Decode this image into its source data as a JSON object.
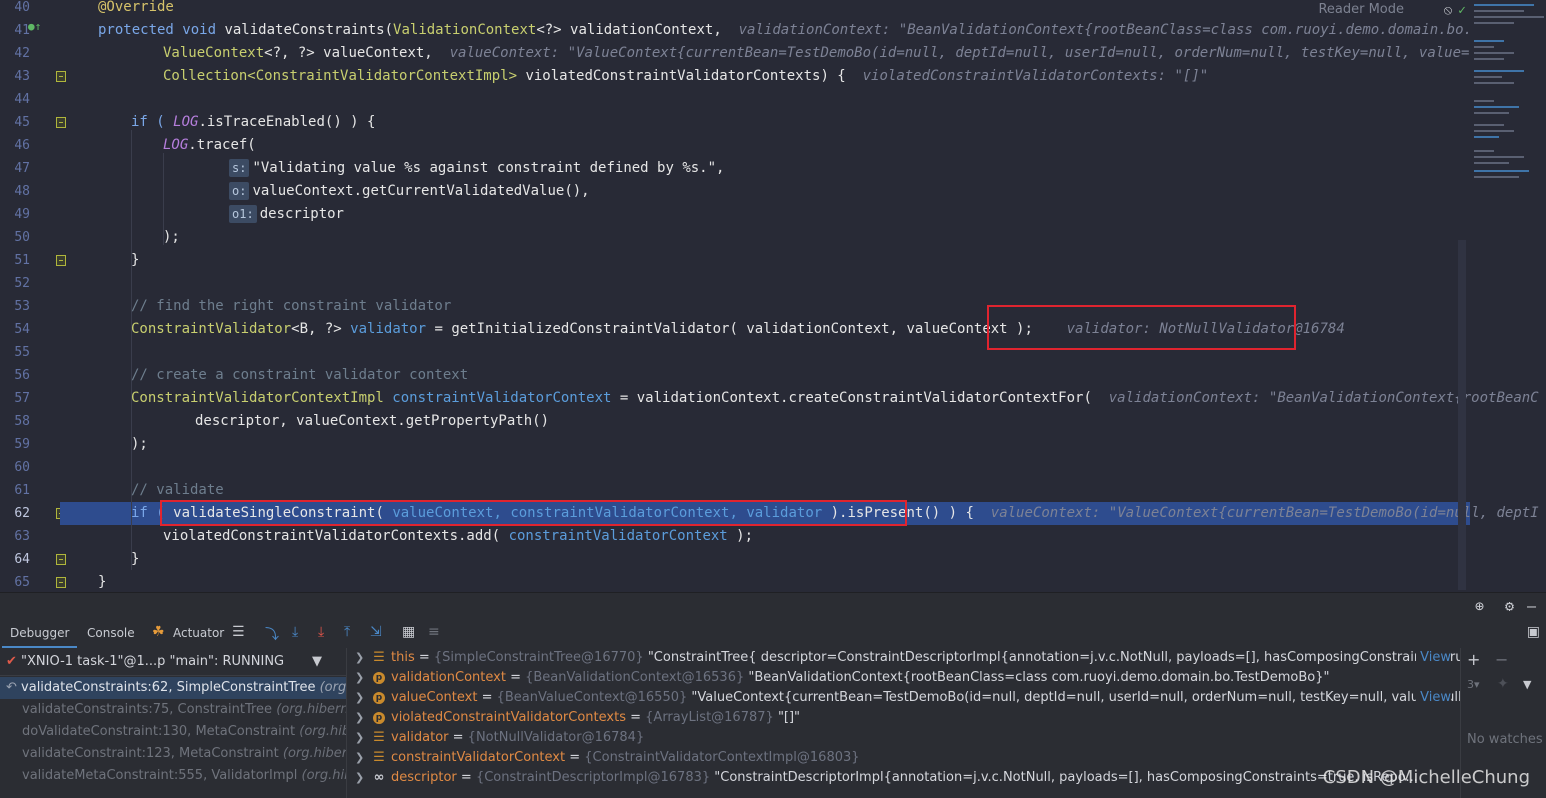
{
  "editor": {
    "reader_mode": "Reader Mode",
    "line_numbers": [
      "40",
      "41",
      "42",
      "43",
      "44",
      "45",
      "46",
      "47",
      "48",
      "49",
      "50",
      "51",
      "52",
      "53",
      "54",
      "55",
      "56",
      "57",
      "58",
      "59",
      "60",
      "61",
      "62",
      "63",
      "64",
      "65"
    ],
    "l40": "@Override",
    "l41_a": "protected void ",
    "l41_b": "validateConstraints",
    "l41_c": "(",
    "l41_d": "ValidationContext",
    "l41_e": "<?> validationContext,",
    "l41_inline": "validationContext: \"BeanValidationContext{rootBeanClass=class com.ruoyi.demo.domain.bo.TestDemo",
    "l42_a": "ValueContext",
    "l42_b": "<?, ?> valueContext,",
    "l42_inline": "valueContext: \"ValueContext{currentBean=TestDemoBo(id=null, deptId=null, userId=null, orderNum=null, testKey=null, value=null), p",
    "l43_a": "Collection",
    "l43_b": "<ConstraintValidatorContextImpl>",
    "l43_c": " violatedConstraintValidatorContexts) {",
    "l43_inline": "violatedConstraintValidatorContexts: \"[]\"",
    "l45_a": "if ( ",
    "l45_b": "LOG",
    "l45_c": ".isTraceEnabled() ) {",
    "l46_a": "LOG",
    "l46_b": ".tracef(",
    "l47_hint": "s:",
    "l47_str": "\"Validating value %s against constraint defined by %s.\",",
    "l48_hint": "o:",
    "l48_code": "valueContext.getCurrentValidatedValue(),",
    "l49_hint": "o1:",
    "l49_code": "descriptor",
    "l50": ");",
    "l51": "}",
    "l53": "// find the right constraint validator",
    "l54_a": "ConstraintValidator",
    "l54_b": "<B, ?> ",
    "l54_c": "validator",
    "l54_d": " = getInitializedConstraintValidator( validationContext, valueContext );",
    "l54_inline": "validator: NotNullValidator@16784",
    "l56": "// create a constraint validator context",
    "l57_a": "ConstraintValidatorContextImpl",
    "l57_b": " constraintValidatorContext",
    "l57_c": " = validationContext.createConstraintValidatorContextFor(",
    "l57_inline": "validationContext: \"BeanValidationContext{rootBeanC",
    "l58": "descriptor, valueContext.getPropertyPath()",
    "l59": ");",
    "l61": "// validate",
    "l62_a": "if ( ",
    "l62_b": "validateSingleConstraint( ",
    "l62_c": "valueContext, constraintValidatorContext, validator",
    "l62_d": " ).isPresent() ) {",
    "l62_inline": "valueContext: \"ValueContext{currentBean=TestDemoBo(id=null, deptI",
    "l63_a": "violatedConstraintValidatorContexts.add( ",
    "l63_b": "constraintValidatorContext",
    "l63_c": " );",
    "l64": "}",
    "l65": "}"
  },
  "debug": {
    "tabs": [
      "Debugger",
      "Console",
      "Actuator"
    ],
    "thread": "\"XNIO-1 task-1\"@1...p \"main\": RUNNING",
    "frames": [
      {
        "method": "validateConstraints:62, SimpleConstraintTree",
        "pkg": "(org.hib"
      },
      {
        "method": "validateConstraints:75, ConstraintTree",
        "pkg": "(org.hibernate"
      },
      {
        "method": "doValidateConstraint:130, MetaConstraint",
        "pkg": "(org.hiber"
      },
      {
        "method": "validateConstraint:123, MetaConstraint",
        "pkg": "(org.hibernat"
      },
      {
        "method": "validateMetaConstraint:555, ValidatorImpl",
        "pkg": "(org.hiber"
      }
    ],
    "variables": [
      {
        "name": "this",
        "type": "{SimpleConstraintTree@16770}",
        "value": "\"ConstraintTree{ descriptor=ConstraintDescriptorImpl{annotation=j.v.c.NotNull, payloads=[], hasComposingConstraints=true, isR...",
        "view": "View",
        "icon": "bars"
      },
      {
        "name": "validationContext",
        "type": "{BeanValidationContext@16536}",
        "value": "\"BeanValidationContext{rootBeanClass=class com.ruoyi.demo.domain.bo.TestDemoBo}\"",
        "view": "",
        "icon": "p"
      },
      {
        "name": "valueContext",
        "type": "{BeanValueContext@16550}",
        "value": "\"ValueContext{currentBean=TestDemoBo(id=null, deptId=null, userId=null, orderNum=null, testKey=null, value=null), pro...",
        "view": "View",
        "icon": "p"
      },
      {
        "name": "violatedConstraintValidatorContexts",
        "type": "{ArrayList@16787}",
        "value": "\"[]\"",
        "view": "",
        "icon": "p"
      },
      {
        "name": "validator",
        "type": "{NotNullValidator@16784}",
        "value": "",
        "view": "",
        "icon": "bars"
      },
      {
        "name": "constraintValidatorContext",
        "type": "{ConstraintValidatorContextImpl@16803}",
        "value": "",
        "view": "",
        "icon": "bars"
      },
      {
        "name": "descriptor",
        "type": "{ConstraintDescriptorImpl@16783}",
        "value": "\"ConstraintDescriptorImpl{annotation=j.v.c.NotNull, payloads=[], hasComposingConstraints=true, isRepo...",
        "view": "",
        "icon": "inf"
      }
    ],
    "no_watches": "No watches",
    "watermark": "CSDN @MichelleChung"
  }
}
